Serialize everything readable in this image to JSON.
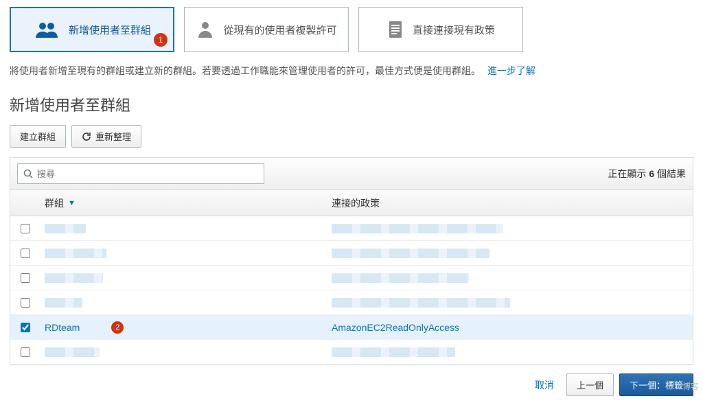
{
  "tabs": {
    "addToGroup": {
      "label": "新增使用者至群組",
      "badge": "1"
    },
    "copyFromUser": {
      "label": "從現有的使用者複製許可"
    },
    "attachPolicy": {
      "label": "直接連接現有政策"
    }
  },
  "description": {
    "text": "將使用者新增至現有的群組或建立新的群組。若要透過工作職能來管理使用者的許可，最佳方式便是使用群組。",
    "link": "進一步了解"
  },
  "section_title": "新增使用者至群組",
  "toolbar": {
    "create_group": "建立群組",
    "refresh": "重新整理"
  },
  "search": {
    "placeholder": "搜尋"
  },
  "results": {
    "prefix": "正在顯示",
    "count": "6",
    "suffix": "個結果"
  },
  "columns": {
    "group": "群組",
    "policy": "連接的政策"
  },
  "rows": [
    {
      "checked": false,
      "group": "",
      "policy": "",
      "blurred": true,
      "groupBlurW": 60,
      "policyBlurW": 250
    },
    {
      "checked": false,
      "group": "",
      "policy": "",
      "blurred": true,
      "groupBlurW": 90,
      "policyBlurW": 230
    },
    {
      "checked": false,
      "group": "",
      "policy": "",
      "blurred": true,
      "groupBlurW": 85,
      "policyBlurW": 200
    },
    {
      "checked": false,
      "group": "",
      "policy": "",
      "blurred": true,
      "groupBlurW": 55,
      "policyBlurW": 260
    },
    {
      "checked": true,
      "group": "RDteam",
      "policy": "AmazonEC2ReadOnlyAccess",
      "blurred": false,
      "badge": "2"
    },
    {
      "checked": false,
      "group": "",
      "policy": "",
      "blurred": true,
      "groupBlurW": 80,
      "policyBlurW": 180
    }
  ],
  "footer": {
    "cancel": "取消",
    "prev": "上一個",
    "next": "下一個：標籤"
  },
  "watermark": "博客"
}
